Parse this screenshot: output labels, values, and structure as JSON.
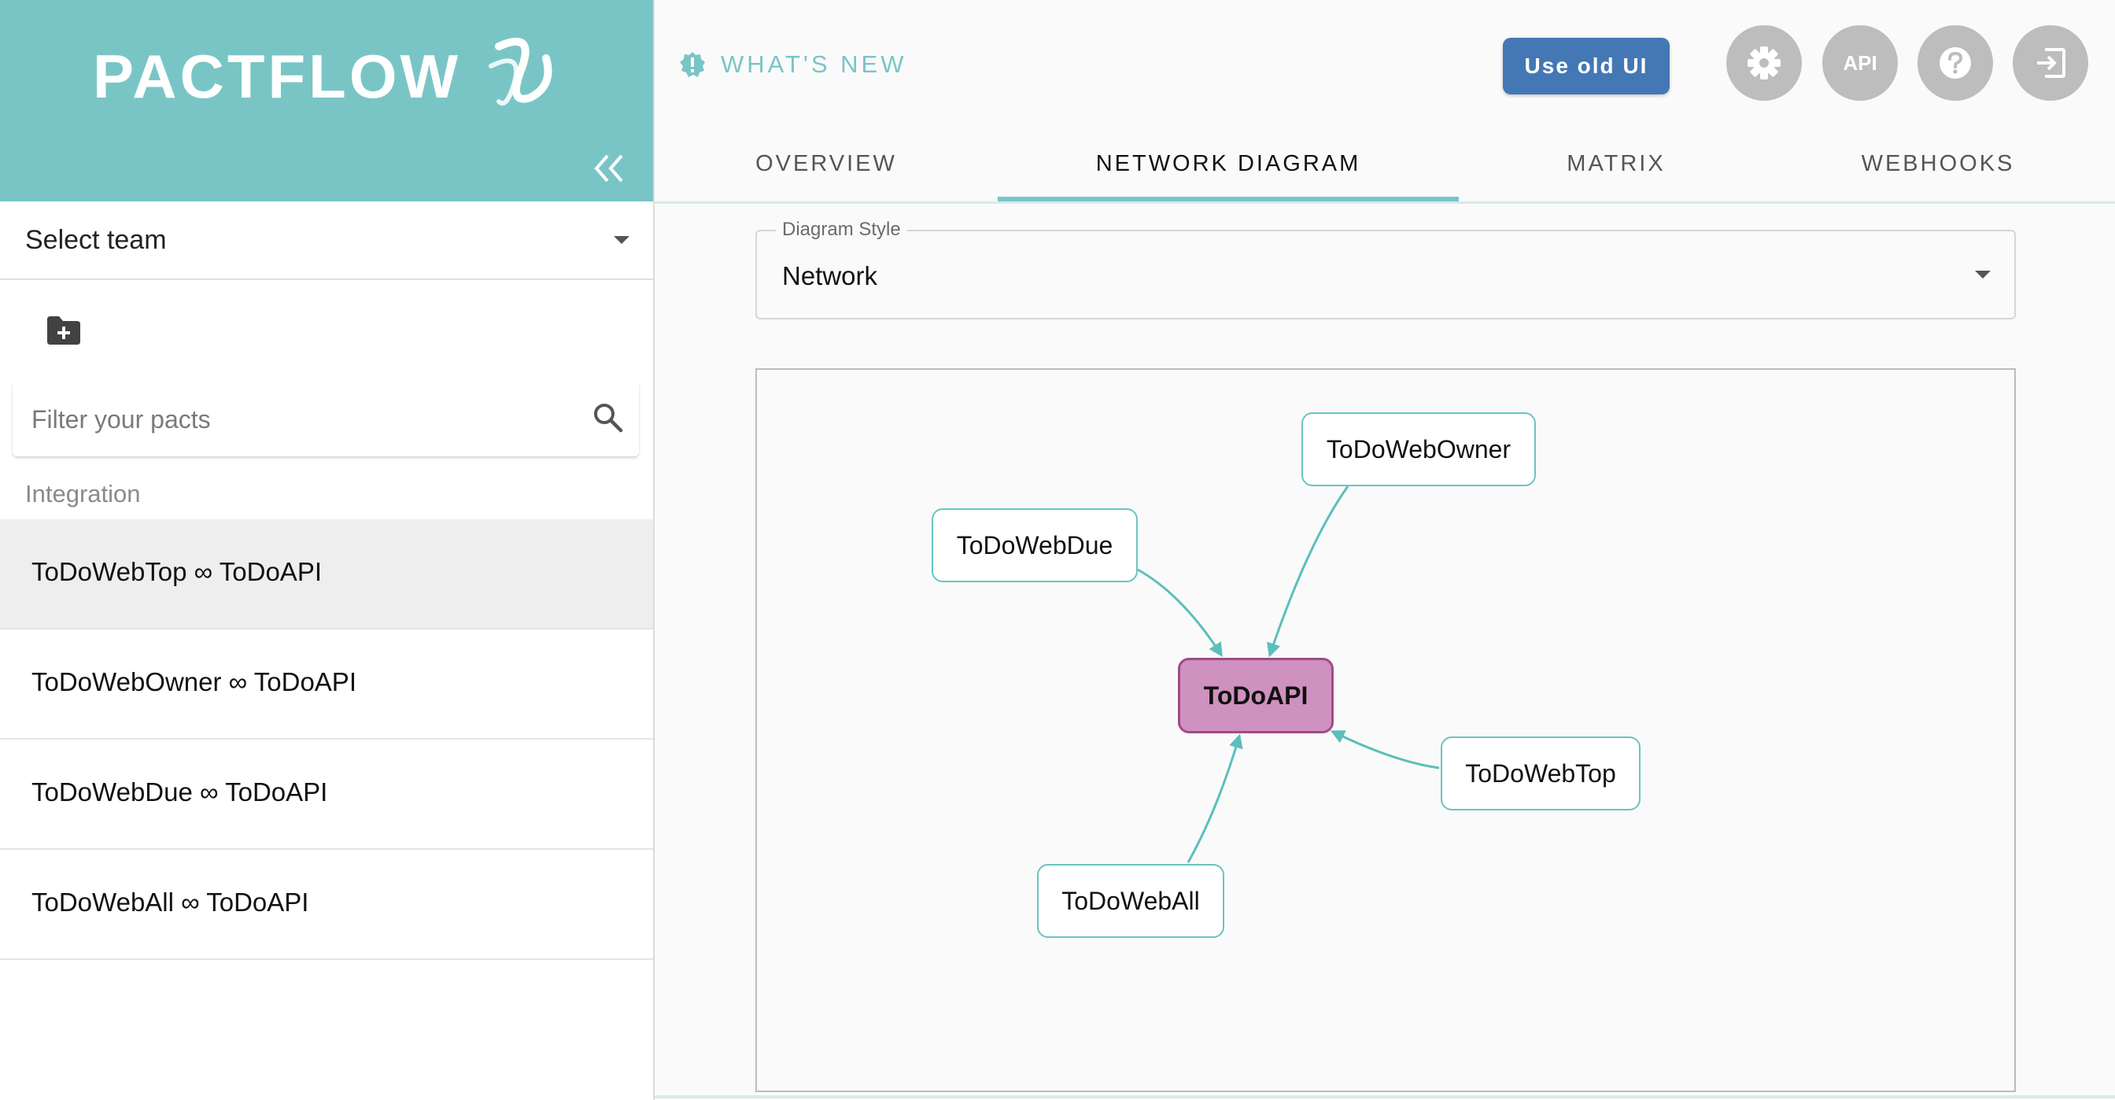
{
  "brand": {
    "name": "PACTFLOW"
  },
  "sidebar": {
    "team_select_label": "Select team",
    "filter_placeholder": "Filter your pacts",
    "section_label": "Integration",
    "items": [
      {
        "label": "ToDoWebTop ∞ ToDoAPI",
        "selected": true
      },
      {
        "label": "ToDoWebOwner ∞ ToDoAPI",
        "selected": false
      },
      {
        "label": "ToDoWebDue ∞ ToDoAPI",
        "selected": false
      },
      {
        "label": "ToDoWebAll ∞ ToDoAPI",
        "selected": false
      }
    ]
  },
  "header": {
    "whats_new": "WHAT'S NEW",
    "old_ui_button": "Use old UI",
    "api_button": "API",
    "icons": [
      "settings-icon",
      "api-icon",
      "help-icon",
      "logout-icon"
    ]
  },
  "tabs": [
    {
      "label": "OVERVIEW",
      "active": false
    },
    {
      "label": "NETWORK DIAGRAM",
      "active": true
    },
    {
      "label": "MATRIX",
      "active": false
    },
    {
      "label": "WEBHOOKS",
      "active": false
    }
  ],
  "diagram_style": {
    "label": "Diagram Style",
    "value": "Network"
  },
  "diagram": {
    "center": "ToDoAPI",
    "nodes": [
      "ToDoWebOwner",
      "ToDoWebDue",
      "ToDoWebTop",
      "ToDoWebAll"
    ]
  },
  "colors": {
    "brand_teal": "#79c5c6",
    "primary_button": "#4378b5",
    "center_node_fill": "#cf91bf",
    "center_node_border": "#a04a88",
    "edge": "#5bbfbb"
  }
}
